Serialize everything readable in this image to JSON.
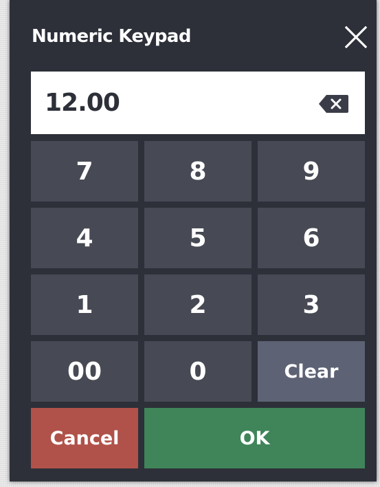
{
  "dialog": {
    "title": "Numeric Keypad",
    "close_icon": "close-icon"
  },
  "display": {
    "value": "12.00",
    "backspace_icon": "backspace-icon"
  },
  "keys": {
    "k7": "7",
    "k8": "8",
    "k9": "9",
    "k4": "4",
    "k5": "5",
    "k6": "6",
    "k1": "1",
    "k2": "2",
    "k3": "3",
    "k00": "00",
    "k0": "0",
    "clear": "Clear"
  },
  "actions": {
    "cancel": "Cancel",
    "ok": "OK"
  },
  "colors": {
    "dialog_bg": "#2d3039",
    "key_bg": "#474a54",
    "clear_bg": "#5d6274",
    "cancel_bg": "#b0524a",
    "ok_bg": "#3f8559"
  }
}
